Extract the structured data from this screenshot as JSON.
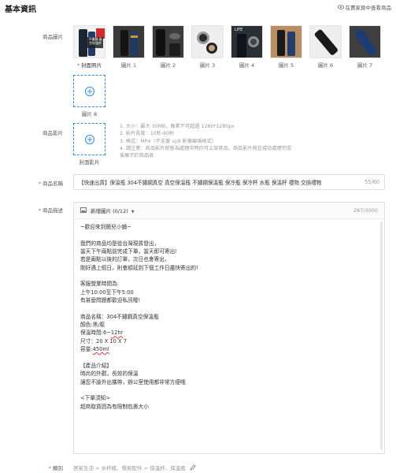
{
  "header": {
    "title": "基本資訊",
    "preview_label": "在賣家頁中查看商品"
  },
  "images": {
    "label": "商品圖片",
    "thumbs": [
      {
        "caption": "封面照片",
        "overlay": "不鏽鋼 真空保溫杯",
        "cover": true
      },
      {
        "caption": "圖片 1"
      },
      {
        "caption": "圖片 2"
      },
      {
        "caption": "圖片 3"
      },
      {
        "caption": "圖片 4",
        "overlay": "LIFE"
      },
      {
        "caption": "圖片 5"
      },
      {
        "caption": "圖片 6"
      },
      {
        "caption": "圖片 7"
      }
    ],
    "add_caption": "圖片 8"
  },
  "video": {
    "label": "商品影片",
    "add_caption": "封面影片",
    "notes": [
      "1. 大小：最大 30MB，像素不可超過 1280*1280px",
      "2. 影片長度：10秒-60秒",
      "3. 格式：MP4（不支援 vp9 影像編碼格式）",
      "4. 請注意：商品影片狀態為處理中時仍可上架商品，商品影片將在成功處理完成",
      "後展示於商品頁"
    ]
  },
  "name": {
    "label": "商品名稱",
    "value": "【快速出貨】保溫瓶 304不鏽鋼真空 真空保溫瓶 不鏽鋼保溫瓶 保冷瓶 保冷杯 水瓶 保溫杯 禮物 交換禮物",
    "count": "55/60"
  },
  "description": {
    "label": "商品描述",
    "add_image_label": "新增圖片 (0/12)",
    "count": "287/3000",
    "lines": [
      "~歡迎來到簡兒小舖~",
      "",
      "我們的商品均是從台灣現貨發出，",
      "當天下午兩點前完成下單，當天即可寄出!",
      "若是兩點以後的訂單，次日也會寄出，",
      "剛好遇上假日，則會順延到下個工作日盡快寄出的!",
      "",
      "客服營業時間為:",
      "上午10:00至下午5:00",
      "有甚麼問題都歡迎私訊喔!",
      "",
      "商品名稱：304不鏽鋼真空保溫瓶",
      "顏色:黑/藍",
      "保溫時間:6~12hr",
      "尺寸：20 X 10 X 7",
      "容量:450ml",
      "",
      "【產品介紹】",
      "時尚的外觀，長效的保溫",
      "讓您不論外出攜帶，辦公室使用都非常方便哦",
      "",
      "<下單須知>",
      "超商取貨因為有限制包裹大小"
    ]
  },
  "category": {
    "label": "類別",
    "path": "居家生活 > 水杯瓶、餐廚配件 > 保溫杯、保溫瓶"
  },
  "colors": {
    "accent": "#ee4d2d",
    "link_blue": "#2d8cf0"
  }
}
